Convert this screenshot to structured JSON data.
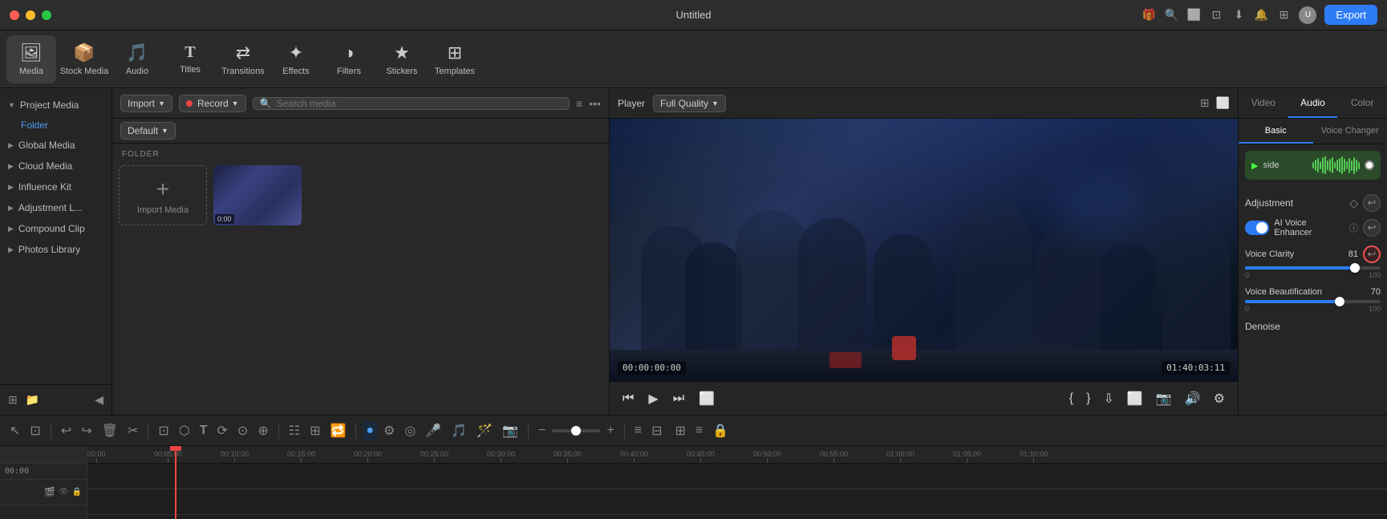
{
  "app": {
    "title": "Untitled",
    "export_label": "Export"
  },
  "titlebar": {
    "traffic_lights": [
      "red",
      "yellow",
      "green"
    ]
  },
  "toolbar": {
    "items": [
      {
        "id": "media",
        "icon": "🖼",
        "label": "Media",
        "active": true
      },
      {
        "id": "stock-media",
        "icon": "📦",
        "label": "Stock Media"
      },
      {
        "id": "audio",
        "icon": "🎵",
        "label": "Audio"
      },
      {
        "id": "titles",
        "icon": "T",
        "label": "Titles"
      },
      {
        "id": "transitions",
        "icon": "↔",
        "label": "Transitions"
      },
      {
        "id": "effects",
        "icon": "✦",
        "label": "Effects"
      },
      {
        "id": "filters",
        "icon": "◑",
        "label": "Filters"
      },
      {
        "id": "stickers",
        "icon": "★",
        "label": "Stickers"
      },
      {
        "id": "templates",
        "icon": "⊞",
        "label": "Templates"
      }
    ]
  },
  "sidebar": {
    "items": [
      {
        "id": "project-media",
        "label": "Project Media",
        "chevron": "▼",
        "indent": false
      },
      {
        "id": "folder",
        "label": "Folder",
        "indent": true
      },
      {
        "id": "global-media",
        "label": "Global Media",
        "chevron": "▶",
        "indent": false
      },
      {
        "id": "cloud-media",
        "label": "Cloud Media",
        "chevron": "▶",
        "indent": false
      },
      {
        "id": "influence-kit",
        "label": "Influence Kit",
        "chevron": "▶",
        "indent": false
      },
      {
        "id": "adjustment-l",
        "label": "Adjustment L...",
        "chevron": "▶",
        "indent": false
      },
      {
        "id": "compound-clip",
        "label": "Compound Clip",
        "chevron": "▶",
        "indent": false
      },
      {
        "id": "photos-library",
        "label": "Photos Library",
        "chevron": "▶",
        "indent": false
      }
    ]
  },
  "media_panel": {
    "import_btn": "Import",
    "record_btn": "Record",
    "default_label": "Default",
    "search_placeholder": "Search media",
    "folder_label": "FOLDER",
    "import_media_label": "Import Media",
    "thumb_timecode": "0:00"
  },
  "video_player": {
    "player_label": "Player",
    "quality": "Full Quality",
    "timecode_left": "00:00:00:00",
    "timecode_right": "01:40:03:11"
  },
  "right_panel": {
    "tabs": [
      "Video",
      "Audio",
      "Color"
    ],
    "active_tab": "Audio",
    "sub_tabs": [
      "Basic",
      "Voice Changer"
    ],
    "active_sub_tab": "Basic",
    "audio_label": "side",
    "adjustment_label": "Adjustment",
    "ai_voice_enhancer_label": "AI Voice Enhancer",
    "ai_voice_enhancer_info": "ⓘ",
    "voice_clarity_label": "Voice Clarity",
    "voice_clarity_value": "81",
    "voice_clarity_min": "0",
    "voice_clarity_max": "100",
    "voice_clarity_fill_pct": 81,
    "voice_beautification_label": "Voice Beautification",
    "voice_beautification_value": "70",
    "voice_beautification_min": "0",
    "voice_beautification_max": "100",
    "voice_beautification_fill_pct": 70,
    "denoise_label": "Denoise"
  },
  "timeline": {
    "tools": [
      "⎋",
      "↖",
      "↩",
      "↪",
      "🗑",
      "✂",
      "⊡",
      "☍",
      "✦",
      "⬡",
      "T",
      "⟳",
      "⊙",
      "⊕",
      "☷",
      "⊞",
      "🔁",
      "⊞",
      "⊞",
      "⊞",
      "⊞",
      "⊞"
    ],
    "ruler_marks": [
      "00:00",
      "00:05:00",
      "00:10:00",
      "00:15:00",
      "00:20:00",
      "00:25:00",
      "00:30:00",
      "00:35:00",
      "00:40:00",
      "00:45:00",
      "00:50:00",
      "00:55:00",
      "01:00:00",
      "01:05:00",
      "01:10:00"
    ],
    "current_time": "00:00"
  }
}
